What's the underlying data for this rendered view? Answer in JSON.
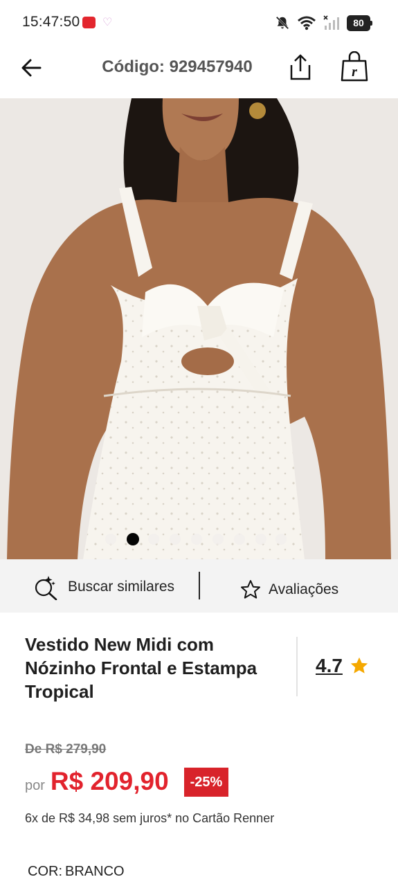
{
  "status_bar": {
    "time": "15:47:50",
    "battery": "80",
    "icons": [
      "app-notification-icon",
      "heart-icon",
      "bell-off-icon",
      "wifi-icon",
      "signal-icon",
      "battery-icon"
    ]
  },
  "header": {
    "title": "Código: 929457940",
    "icons": [
      "back-arrow-icon",
      "share-icon",
      "shopping-bag-icon"
    ]
  },
  "gallery": {
    "image_description_icon": "product-photo",
    "total_images": 9,
    "active_index": 1
  },
  "actions": {
    "similar_label": "Buscar similares",
    "reviews_label": "Avaliações",
    "icons": [
      "sparkle-search-icon",
      "star-outline-icon"
    ]
  },
  "product": {
    "name": "Vestido New Midi com Nózinho Frontal e Estampa Tropical",
    "rating": "4.7",
    "old_price": "De R$ 279,90",
    "price_prefix": "por",
    "price": "R$ 209,90",
    "discount": "-25%",
    "installments": "6x de R$ 34,98 sem juros* no Cartão Renner",
    "color_label": "COR:",
    "color_value": "BRANCO"
  },
  "colors": {
    "price_red": "#e2232d",
    "badge_red": "#d8232a",
    "star_yellow": "#f5a800",
    "action_bar_bg": "#f3f3f3"
  }
}
